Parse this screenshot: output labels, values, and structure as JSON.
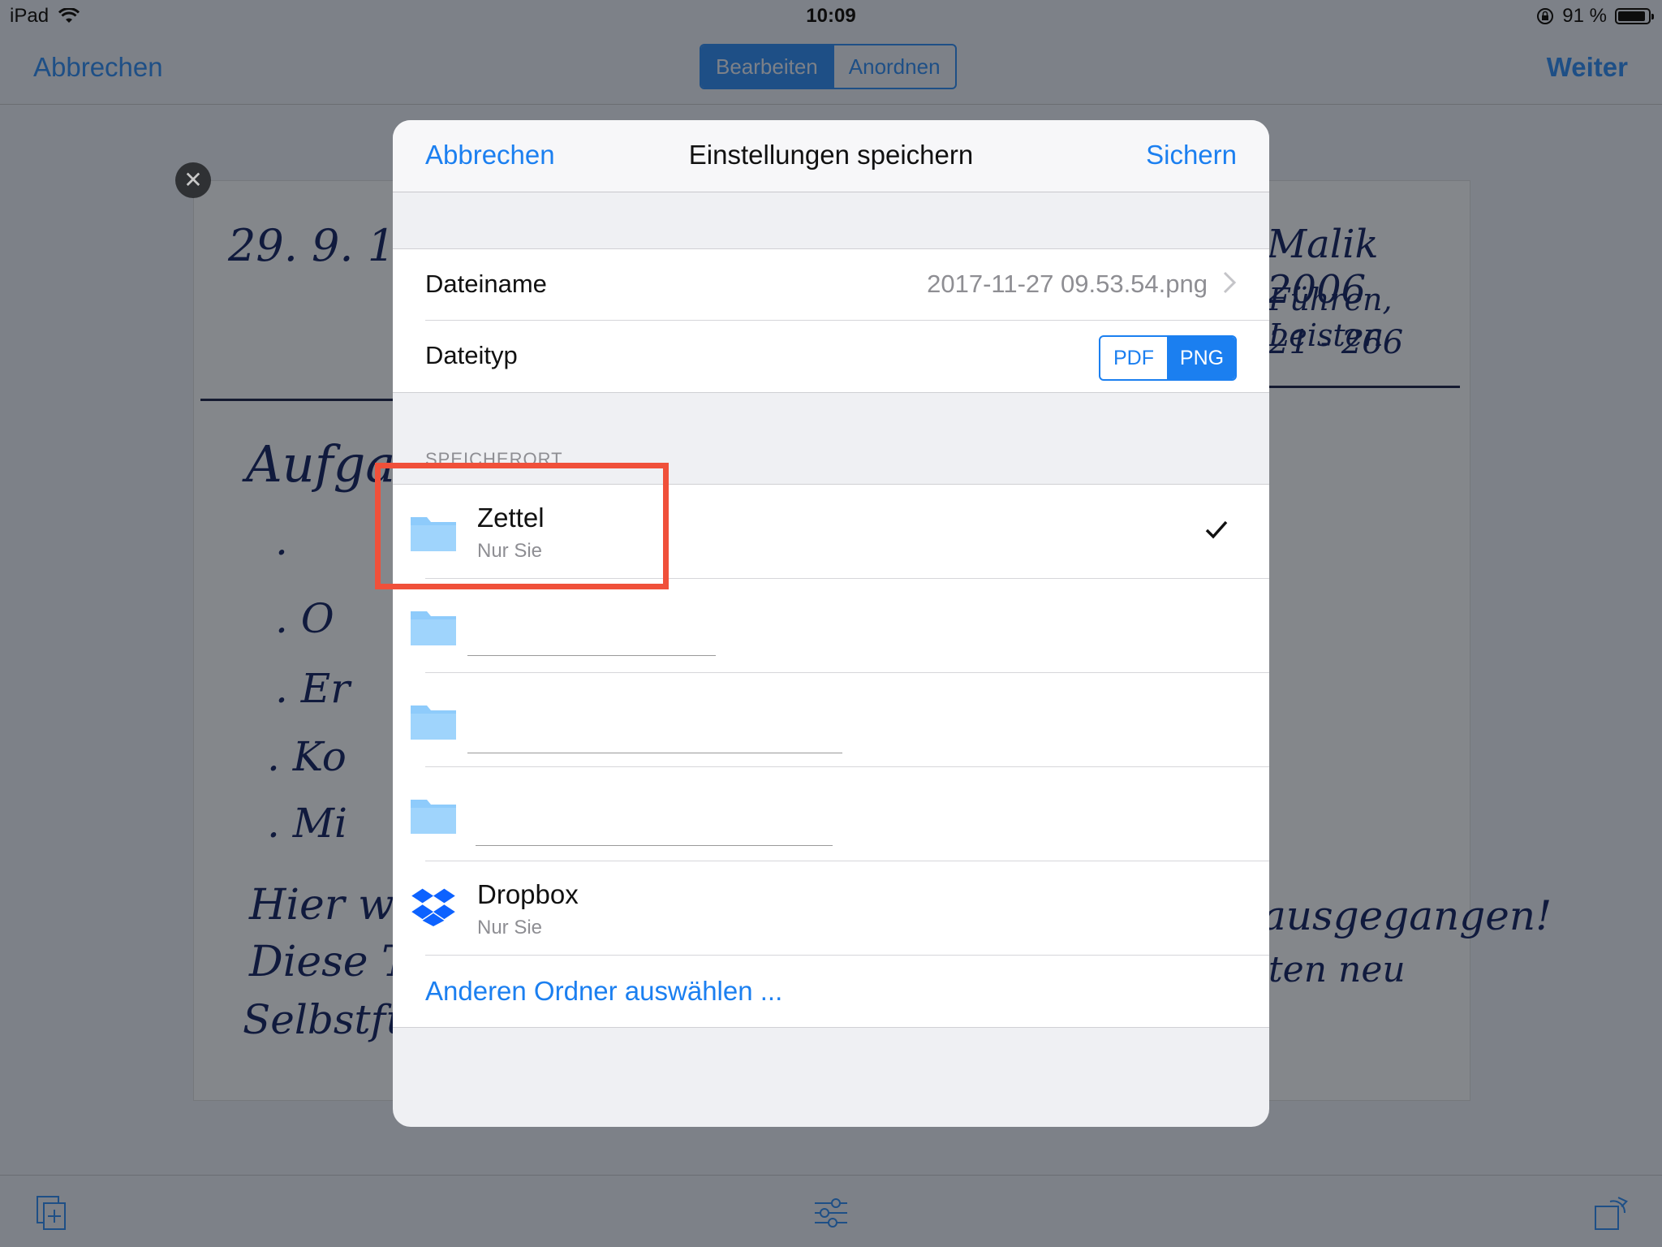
{
  "status_bar": {
    "device": "iPad",
    "time": "10:09",
    "battery_text": "91 %",
    "battery_level": 0.91
  },
  "nav": {
    "cancel_label": "Abbrechen",
    "segments": [
      "Bearbeiten",
      "Anordnen"
    ],
    "next_label": "Weiter"
  },
  "handwriting": {
    "date": "29. 9. 1",
    "top_right_1": "Malik 2006",
    "top_right_2": "Führen, Leisten",
    "top_right_3": "21 - 266",
    "heading": "Aufga",
    "bullets": [
      ". ",
      ". O",
      ". Er",
      ". Ko",
      ". Mi"
    ],
    "bottom_left_1": "Hier wir",
    "bottom_left_2": "Diese T",
    "bottom_left_3": "Selbstführu",
    "bottom_right_1": "ausgegangen!",
    "bottom_right_2": "ten neu"
  },
  "modal": {
    "cancel_label": "Abbrechen",
    "title": "Einstellungen speichern",
    "save_label": "Sichern",
    "filename_label": "Dateiname",
    "filename_value": "2017-11-27 09.53.54.png",
    "filetype_label": "Dateityp",
    "filetype_options": [
      "PDF",
      "PNG"
    ],
    "filetype_selected": "PNG",
    "section_label": "SPEICHERORT",
    "folders": [
      {
        "name": "Zettel",
        "sub": "Nur Sie",
        "selected": true
      },
      {
        "name": "",
        "sub": ""
      },
      {
        "name": "",
        "sub": ""
      },
      {
        "name": "",
        "sub": ""
      }
    ],
    "dropbox": {
      "name": "Dropbox",
      "sub": "Nur Sie"
    },
    "other_folder_label": "Anderen Ordner auswählen ..."
  },
  "colors": {
    "accent": "#1b7ff0",
    "dim_accent": "#1e4f86",
    "folder": "#8ecbfb",
    "highlight": "#f0503a",
    "dropbox": "#0d62ff"
  }
}
